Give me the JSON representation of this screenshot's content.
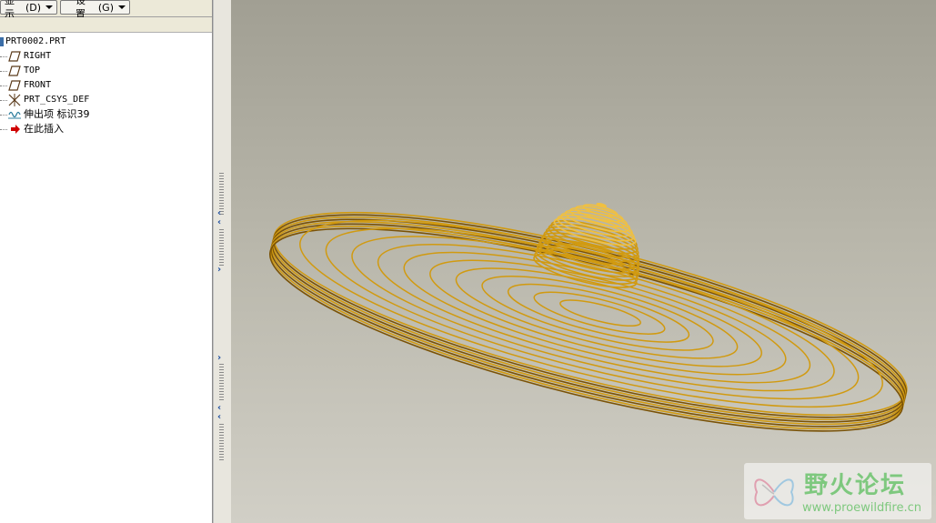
{
  "menu": {
    "display_label": "显示",
    "display_accel": "(D)",
    "settings_label": "设置",
    "settings_accel": "(G)"
  },
  "model_tree": {
    "root": "PRT0002.PRT",
    "items": [
      {
        "label": "RIGHT",
        "icon": "datum-plane-icon"
      },
      {
        "label": "TOP",
        "icon": "datum-plane-icon"
      },
      {
        "label": "FRONT",
        "icon": "datum-plane-icon"
      },
      {
        "label": "PRT_CSYS_DEF",
        "icon": "csys-icon"
      },
      {
        "label": "伸出项 标识39",
        "icon": "protrusion-icon"
      },
      {
        "label": "在此插入",
        "icon": "insert-here-arrow-icon"
      }
    ]
  },
  "viewport": {
    "background_top": "#a19f93",
    "background_bottom": "#d1cfc6",
    "model_color": "#d19a10",
    "model_highlight": "#f0c040",
    "model_shadow": "#7a5206",
    "disk_rings": 11,
    "rim_lines": 8,
    "dome_rings": 18
  },
  "watermark": {
    "brand": "野火论坛",
    "url": "www.proewildfire.cn"
  }
}
